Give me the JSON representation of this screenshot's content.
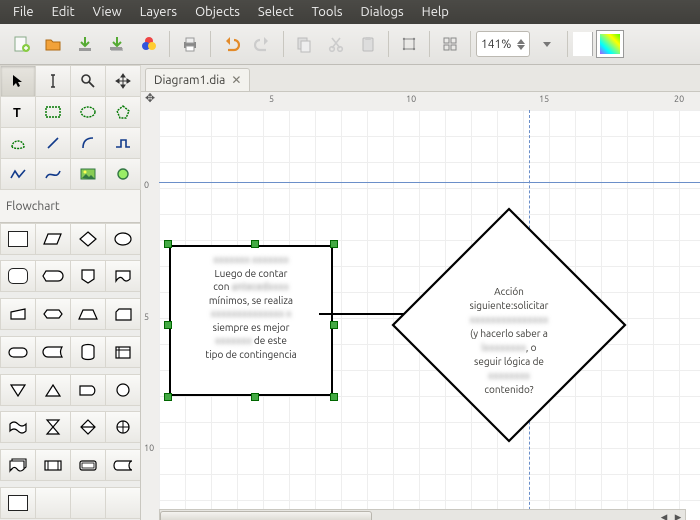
{
  "menu": {
    "items": [
      "File",
      "Edit",
      "View",
      "Layers",
      "Objects",
      "Select",
      "Tools",
      "Dialogs",
      "Help"
    ]
  },
  "toolbar": {
    "zoom_value": "141%",
    "buttons": [
      "new-file",
      "open-file",
      "save",
      "save-as",
      "export",
      "sep",
      "print",
      "sep",
      "undo",
      "redo",
      "sep",
      "copy",
      "cut",
      "paste",
      "sep",
      "zoom-out",
      "sep",
      "zoom-fit",
      "sep"
    ]
  },
  "tab": {
    "label": "Diagram1.dia"
  },
  "ruler": {
    "h": [
      "5",
      "10",
      "15",
      "20"
    ],
    "v": [
      "0",
      "5",
      "10"
    ]
  },
  "sheets": {
    "active": "Flowchart"
  },
  "tools": {
    "grid": [
      "pointer",
      "text-cursor",
      "magnify",
      "move",
      "text",
      "box",
      "ellipse",
      "polygon",
      "bezier-shape",
      "line",
      "arc",
      "zigzag",
      "polyline",
      "bezier-line",
      "image",
      "outline"
    ]
  },
  "shape_palette": {
    "rows": 8,
    "cols": 4
  },
  "diagram": {
    "process": {
      "lines": [
        {
          "t": "xxxxxxx  xxxxxxx",
          "blur": true
        },
        {
          "t": "Luego de contar",
          "blur": false
        },
        {
          "t": "con xxxxxxxxxx",
          "blur": true
        },
        {
          "t": "mínimos, se realiza",
          "blur": false
        },
        {
          "t": "xxxxxxxxxxxxxx x",
          "blur": true
        },
        {
          "t": "siempre es mejor",
          "blur": false
        },
        {
          "t": "xxxxxxx de este",
          "blur": true
        },
        {
          "t": "tipo de contingencia",
          "blur": false
        }
      ]
    },
    "decision": {
      "lines": [
        {
          "t": "Acción",
          "blur": false
        },
        {
          "t": "siguiente:solicitar",
          "blur": false
        },
        {
          "t": "xxxxxxxxxxxxxxx",
          "blur": true
        },
        {
          "t": "(y hacerlo saber a",
          "blur": false
        },
        {
          "t": "xxxxxxxxx), o",
          "blur": true
        },
        {
          "t": "seguir lógica de",
          "blur": false
        },
        {
          "t": "xxxxxxxx",
          "blur": true
        },
        {
          "t": "contenido?",
          "blur": false
        }
      ]
    }
  }
}
